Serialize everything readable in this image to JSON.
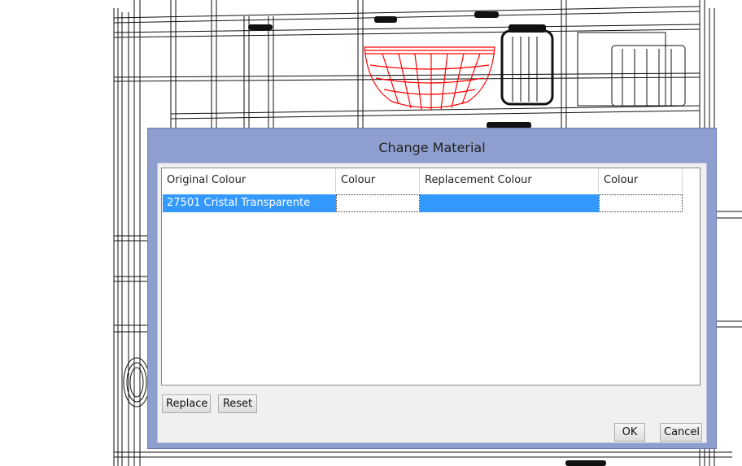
{
  "dialog": {
    "title": "Change Material",
    "columns": [
      "Original Colour",
      "Colour",
      "Replacement Colour",
      "Colour"
    ],
    "rows": [
      {
        "original": "27501 Cristal Transparente",
        "colour": "",
        "replacement": "",
        "replacement_colour": ""
      }
    ],
    "buttons": {
      "replace": "Replace",
      "reset": "Reset",
      "ok": "OK",
      "cancel": "Cancel"
    }
  },
  "colors": {
    "selection": "#3399ff",
    "title_bar": "#8e9fcf",
    "highlighted_object": "#ff0000"
  }
}
